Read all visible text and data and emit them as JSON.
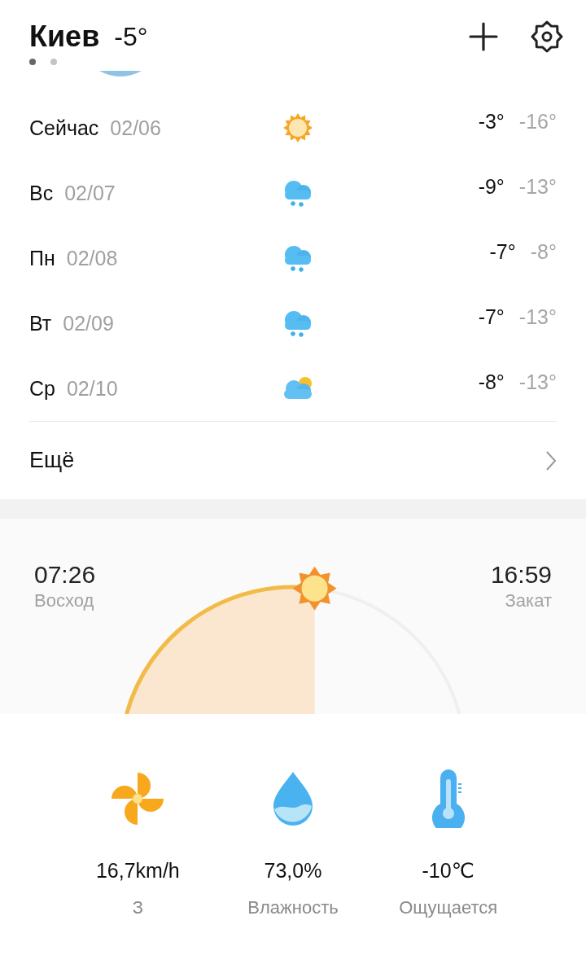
{
  "header": {
    "city": "Киев",
    "temperature": "-5°"
  },
  "pages": [
    {
      "selected": true
    },
    {
      "selected": false
    }
  ],
  "forecast": [
    {
      "day": "Сейчас",
      "date": "02/06",
      "kind": "sunny",
      "high": "-3°",
      "low": "-16°"
    },
    {
      "day": "Вс",
      "date": "02/07",
      "kind": "snow",
      "high": "-9°",
      "low": "-13°"
    },
    {
      "day": "Пн",
      "date": "02/08",
      "kind": "snow",
      "high": "-7°",
      "low": "-8°"
    },
    {
      "day": "Вт",
      "date": "02/09",
      "kind": "snow",
      "high": "-7°",
      "low": "-13°"
    },
    {
      "day": "Ср",
      "date": "02/10",
      "kind": "partly-cloudy",
      "high": "-8°",
      "low": "-13°"
    }
  ],
  "more": {
    "label": "Ещё"
  },
  "sun": {
    "sunrise": "07:26",
    "sunrise_label": "Восход",
    "sunset": "16:59",
    "sunset_label": "Закат",
    "level": 0.54
  },
  "details": [
    {
      "kind": "wind",
      "value": "16,7km/h",
      "label": "З"
    },
    {
      "kind": "humidity",
      "value": "73,0%",
      "label": "Влажность"
    },
    {
      "kind": "feels",
      "value": "-10℃",
      "label": "Ощущается"
    }
  ]
}
